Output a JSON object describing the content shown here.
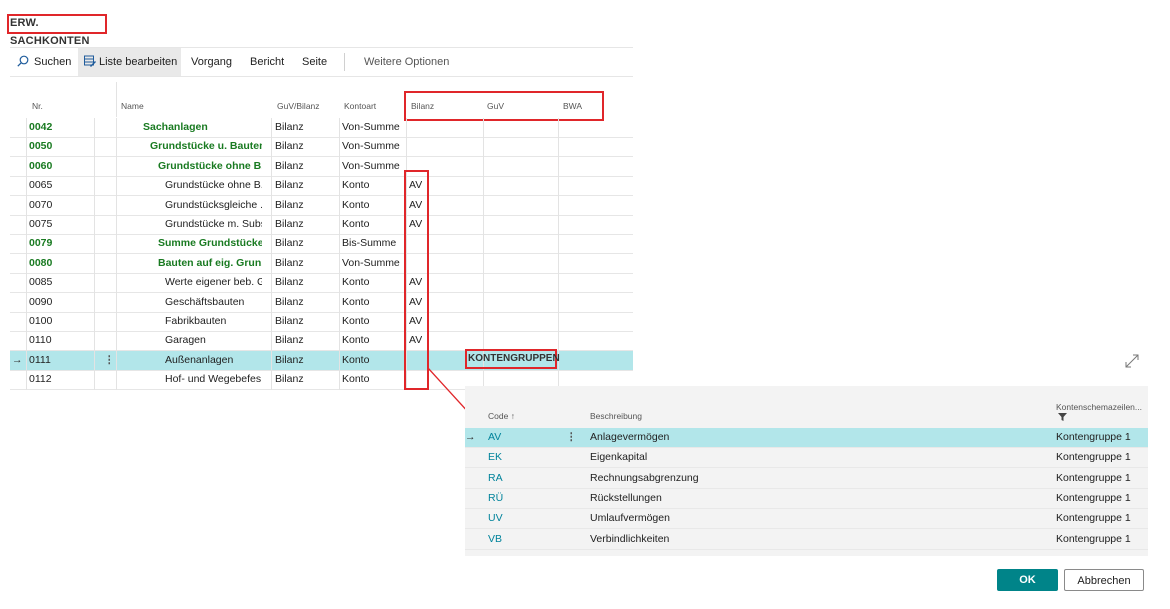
{
  "page_title": "ERW. SACHKONTEN",
  "toolbar": {
    "search": "Suchen",
    "edit_list": "Liste bearbeiten",
    "process": "Vorgang",
    "report": "Bericht",
    "page": "Seite",
    "more_options": "Weitere Optionen"
  },
  "columns": {
    "nr": "Nr.",
    "name": "Name",
    "guv_bilanz": "GuV/Bilanz",
    "kontoart": "Kontoart",
    "bilanz": "Bilanz",
    "guv": "GuV",
    "bwa": "BWA"
  },
  "rows": [
    {
      "nr": "0042",
      "name": "Sachanlagen",
      "gb": "Bilanz",
      "art": "Von-Summe",
      "bil": ""
    },
    {
      "nr": "0050",
      "name": "Grundstücke u. Bauten",
      "gb": "Bilanz",
      "art": "Von-Summe",
      "bil": ""
    },
    {
      "nr": "0060",
      "name": "Grundstücke ohne B...",
      "gb": "Bilanz",
      "art": "Von-Summe",
      "bil": ""
    },
    {
      "nr": "0065",
      "name": "Grundstücke ohne B...",
      "gb": "Bilanz",
      "art": "Konto",
      "bil": "AV"
    },
    {
      "nr": "0070",
      "name": "Grundstücksgleiche ...",
      "gb": "Bilanz",
      "art": "Konto",
      "bil": "AV"
    },
    {
      "nr": "0075",
      "name": "Grundstücke m. Subs...",
      "gb": "Bilanz",
      "art": "Konto",
      "bil": "AV"
    },
    {
      "nr": "0079",
      "name": "Summe Grundstücke...",
      "gb": "Bilanz",
      "art": "Bis-Summe",
      "bil": ""
    },
    {
      "nr": "0080",
      "name": "Bauten auf eig. Grun...",
      "gb": "Bilanz",
      "art": "Von-Summe",
      "bil": ""
    },
    {
      "nr": "0085",
      "name": "Werte eigener beb. G...",
      "gb": "Bilanz",
      "art": "Konto",
      "bil": "AV"
    },
    {
      "nr": "0090",
      "name": "Geschäftsbauten",
      "gb": "Bilanz",
      "art": "Konto",
      "bil": "AV"
    },
    {
      "nr": "0100",
      "name": "Fabrikbauten",
      "gb": "Bilanz",
      "art": "Konto",
      "bil": "AV"
    },
    {
      "nr": "0110",
      "name": "Garagen",
      "gb": "Bilanz",
      "art": "Konto",
      "bil": "AV"
    },
    {
      "nr": "0111",
      "name": "Außenanlagen",
      "gb": "Bilanz",
      "art": "Konto",
      "bil": ""
    },
    {
      "nr": "0112",
      "name": "Hof- und Wegebefes...",
      "gb": "Bilanz",
      "art": "Konto",
      "bil": ""
    }
  ],
  "lookup": {
    "title": "KONTENGRUPPEN",
    "col_code": "Code",
    "col_code_sort": "↑",
    "col_desc": "Beschreibung",
    "col_schema": "Kontenschemazeilen...",
    "rows": [
      {
        "code": "AV",
        "desc": "Anlagevermögen",
        "schema": "Kontengruppe 1"
      },
      {
        "code": "EK",
        "desc": "Eigenkapital",
        "schema": "Kontengruppe 1"
      },
      {
        "code": "RA",
        "desc": "Rechnungsabgrenzung",
        "schema": "Kontengruppe 1"
      },
      {
        "code": "RÜ",
        "desc": "Rückstellungen",
        "schema": "Kontengruppe 1"
      },
      {
        "code": "UV",
        "desc": "Umlaufvermögen",
        "schema": "Kontengruppe 1"
      },
      {
        "code": "VB",
        "desc": "Verbindlichkeiten",
        "schema": "Kontengruppe 1"
      }
    ]
  },
  "buttons": {
    "ok": "OK",
    "cancel": "Abbrechen"
  },
  "colors": {
    "accent": "#00839b",
    "ok_button": "#008489",
    "highlight": "#e0262a",
    "selected_row": "#b2e6ea",
    "group_text": "#197a21"
  }
}
